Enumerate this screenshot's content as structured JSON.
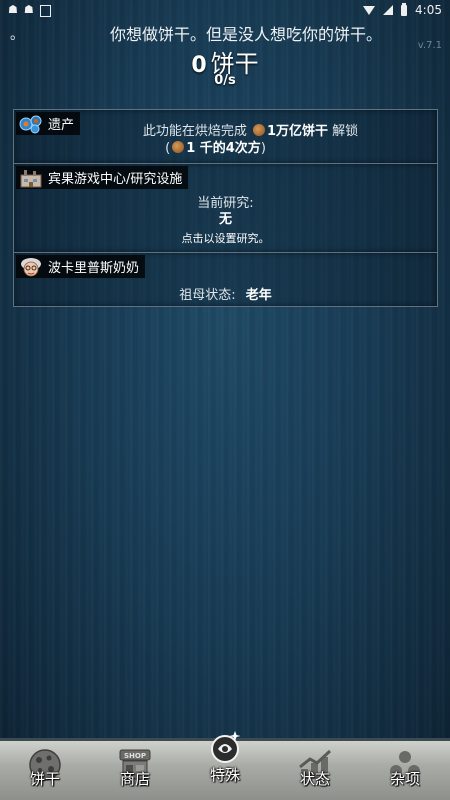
{
  "statusbar": {
    "left_icons": [
      "bug-icon",
      "bug-icon",
      "notification-box-icon"
    ],
    "time": "4:05",
    "right_icons": [
      "wifi-icon",
      "signal-icon",
      "battery-icon"
    ]
  },
  "header": {
    "bullet": "。",
    "news": "你想做饼干。但是没人想吃你的饼干。",
    "version": "v.7.1",
    "cookie_count": "0",
    "cookie_unit": "饼干",
    "per_second": "0/s"
  },
  "panels": {
    "legacy": {
      "title": "遗产",
      "icon": "legacy-icon",
      "line1_prefix": "此功能在烘焙完成",
      "line1_amount": "1万亿饼干",
      "line1_suffix": "解锁",
      "line2_open": "(",
      "line2_amount": "1 千的4次方",
      "line2_close": ")"
    },
    "research": {
      "title": "宾果游戏中心/研究设施",
      "icon": "research-facility-icon",
      "current_label": "当前研究:",
      "current_value": "无",
      "hint": "点击以设置研究。"
    },
    "grandmapocalypse": {
      "title": "波卡里普斯奶奶",
      "icon": "grandma-icon",
      "status_label": "祖母状态:",
      "status_value": "老年"
    }
  },
  "bottom_nav": [
    {
      "label": "饼干",
      "icon": "cookie-icon"
    },
    {
      "label": "商店",
      "icon": "shop-icon"
    },
    {
      "label": "特殊",
      "icon": "special-icon"
    },
    {
      "label": "状态",
      "icon": "stats-icon"
    },
    {
      "label": "杂项",
      "icon": "misc-icon"
    }
  ],
  "colors": {
    "background": "#163247",
    "panel_border": "#5d7384",
    "nav_bg": "#a9aba6"
  }
}
